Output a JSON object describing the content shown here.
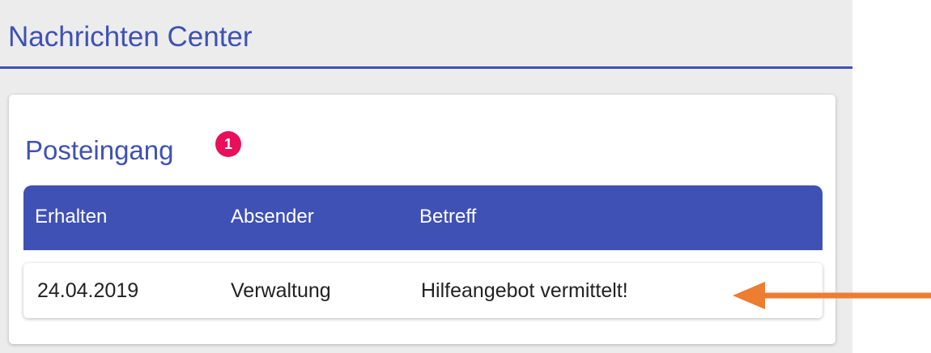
{
  "header": {
    "title": "Nachrichten Center"
  },
  "inbox": {
    "title": "Posteingang",
    "unread_count": "1",
    "columns": [
      "Erhalten",
      "Absender",
      "Betreff"
    ],
    "rows": [
      {
        "received": "24.04.2019",
        "sender": "Verwaltung",
        "subject": "Hilfeangebot vermittelt!"
      }
    ]
  },
  "colors": {
    "accent": "#3f51b5",
    "badge": "#e8105a",
    "annotation_arrow": "#ed7d31",
    "background": "#ececec"
  },
  "icons": {
    "annotation": "arrow-left-icon"
  }
}
